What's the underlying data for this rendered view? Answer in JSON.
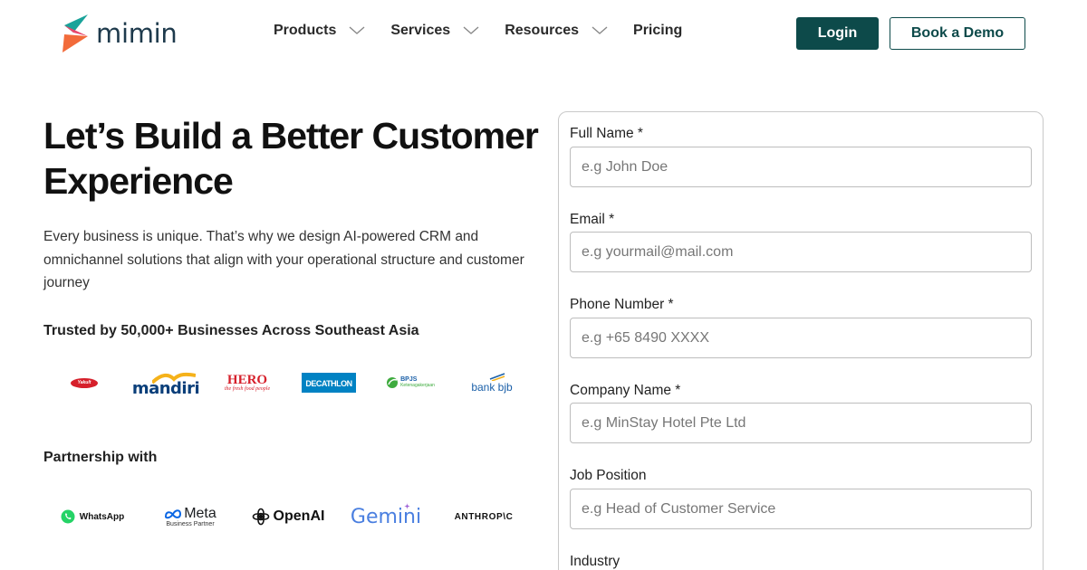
{
  "brand": {
    "name": "mimin"
  },
  "nav": {
    "items": [
      {
        "label": "Products",
        "has_dropdown": true
      },
      {
        "label": "Services",
        "has_dropdown": true
      },
      {
        "label": "Resources",
        "has_dropdown": true
      },
      {
        "label": "Pricing",
        "has_dropdown": false
      }
    ],
    "login_label": "Login",
    "demo_label": "Book a Demo"
  },
  "hero": {
    "title_line1": "Let’s Build a Better Customer",
    "title_line2": "Experience",
    "description": "Every business is unique. That’s why we design AI-powered CRM and omnichannel solutions that align with your operational structure and customer journey",
    "trusted_label": "Trusted by 50,000+ Businesses Across Southeast Asia",
    "clients": {
      "c1": "Yakult",
      "c2": "mandiri",
      "c3": "HERO",
      "c3_tag": "the fresh food people",
      "c4": "DECATHLON",
      "c5": "BPJS",
      "c5_tag": "Ketenagakerjaan",
      "c6": "bank bjb"
    },
    "partner_label": "Partnership with",
    "partners": {
      "p1": "WhatsApp",
      "p2": "Meta",
      "p2_tag": "Business Partner",
      "p3": "OpenAI",
      "p4": "Gemini",
      "p5": "ANTHROP\\C"
    }
  },
  "form": {
    "fields": [
      {
        "label": "Full Name *",
        "placeholder": "e.g John Doe"
      },
      {
        "label": "Email *",
        "placeholder": "e.g yourmail@mail.com"
      },
      {
        "label": "Phone Number *",
        "placeholder": "e.g +65 8490 XXXX"
      },
      {
        "label": "Company Name *",
        "placeholder": "e.g MinStay Hotel Pte Ltd"
      },
      {
        "label": "Job Position",
        "placeholder": "e.g Head of Customer Service"
      },
      {
        "label": "Industry"
      }
    ]
  },
  "colors": {
    "primary": "#0d4a4a",
    "logo_orange": "#f26b3a",
    "logo_teal": "#1aa39a",
    "logo_pink": "#e8476b"
  }
}
